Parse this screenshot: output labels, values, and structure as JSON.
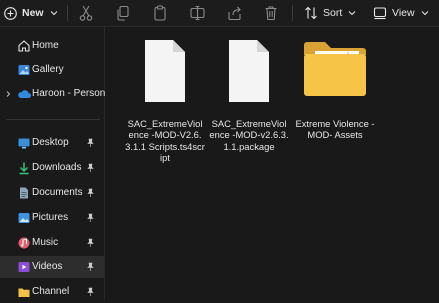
{
  "toolbar": {
    "new_label": "New",
    "sort_label": "Sort",
    "view_label": "View"
  },
  "sidebar": {
    "items": [
      {
        "label": "Home",
        "icon": "home-icon"
      },
      {
        "label": "Gallery",
        "icon": "gallery-icon"
      },
      {
        "label": "Haroon - Person",
        "icon": "onedrive-cloud-icon"
      }
    ],
    "quick_access": [
      {
        "label": "Desktop",
        "icon": "desktop-icon",
        "pinned": true
      },
      {
        "label": "Downloads",
        "icon": "downloads-icon",
        "pinned": true
      },
      {
        "label": "Documents",
        "icon": "documents-icon",
        "pinned": true
      },
      {
        "label": "Pictures",
        "icon": "pictures-icon",
        "pinned": true
      },
      {
        "label": "Music",
        "icon": "music-icon",
        "pinned": true
      },
      {
        "label": "Videos",
        "icon": "videos-icon",
        "pinned": true,
        "selected": true
      },
      {
        "label": "Channel",
        "icon": "folder-icon",
        "pinned": true
      }
    ]
  },
  "files": [
    {
      "name": "SAC_ExtremeViolence -MOD-V2.6.3.1.1 Scripts.ts4script",
      "type": "file"
    },
    {
      "name": "SAC_ExtremeViolence -MOD-v2.6.3.1.1.package",
      "type": "file"
    },
    {
      "name": "Extreme Violence -MOD- Assets",
      "type": "folder"
    }
  ],
  "colors": {
    "background": "#191919",
    "selected": "#2d2d2d",
    "folder": "#f3c04a",
    "onedrive": "#2f8ae0"
  }
}
